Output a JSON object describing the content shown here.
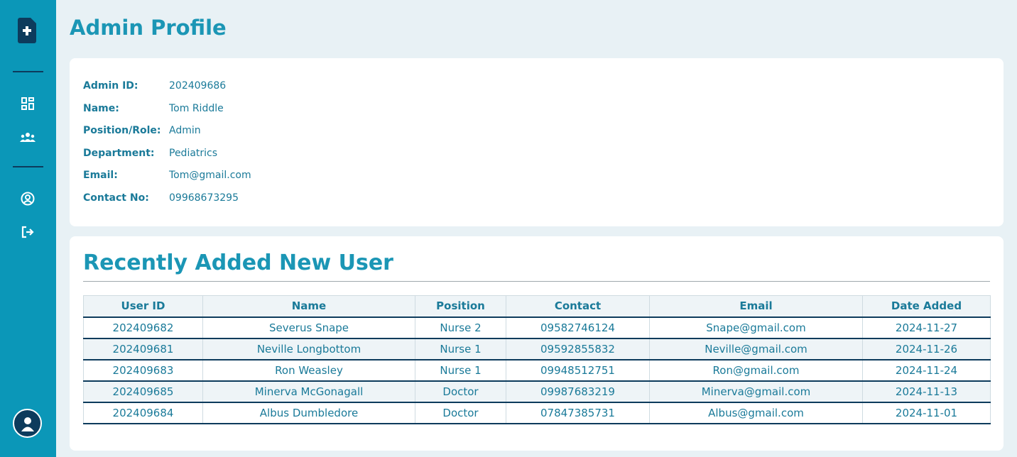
{
  "page": {
    "title": "Admin Profile"
  },
  "colors": {
    "sidebar": "#0b97b8",
    "accent": "#1b96b5",
    "dark": "#0d3b5c",
    "background": "#e8f1f5"
  },
  "sidebar": {
    "logo_icon": "medical-file-plus-icon",
    "items": [
      {
        "icon": "dashboard-icon"
      },
      {
        "icon": "users-group-icon"
      },
      {
        "icon": "user-circle-icon"
      },
      {
        "icon": "logout-icon"
      }
    ],
    "avatar_icon": "user-avatar-icon"
  },
  "profile": {
    "fields": [
      {
        "label": "Admin ID:",
        "value": "202409686"
      },
      {
        "label": "Name:",
        "value": "Tom Riddle"
      },
      {
        "label": "Position/Role:",
        "value": "Admin"
      },
      {
        "label": "Department:",
        "value": "Pediatrics"
      },
      {
        "label": "Email:",
        "value": "Tom@gmail.com"
      },
      {
        "label": "Contact No:",
        "value": "09968673295"
      }
    ]
  },
  "recent_users": {
    "title": "Recently Added New User",
    "columns": [
      "User ID",
      "Name",
      "Position",
      "Contact",
      "Email",
      "Date Added"
    ],
    "rows": [
      [
        "202409682",
        "Severus Snape",
        "Nurse 2",
        "09582746124",
        "Snape@gmail.com",
        "2024-11-27"
      ],
      [
        "202409681",
        "Neville Longbottom",
        "Nurse 1",
        "09592855832",
        "Neville@gmail.com",
        "2024-11-26"
      ],
      [
        "202409683",
        "Ron Weasley",
        "Nurse 1",
        "09948512751",
        "Ron@gmail.com",
        "2024-11-24"
      ],
      [
        "202409685",
        "Minerva McGonagall",
        "Doctor",
        "09987683219",
        "Minerva@gmail.com",
        "2024-11-13"
      ],
      [
        "202409684",
        "Albus Dumbledore",
        "Doctor",
        "07847385731",
        "Albus@gmail.com",
        "2024-11-01"
      ]
    ]
  }
}
